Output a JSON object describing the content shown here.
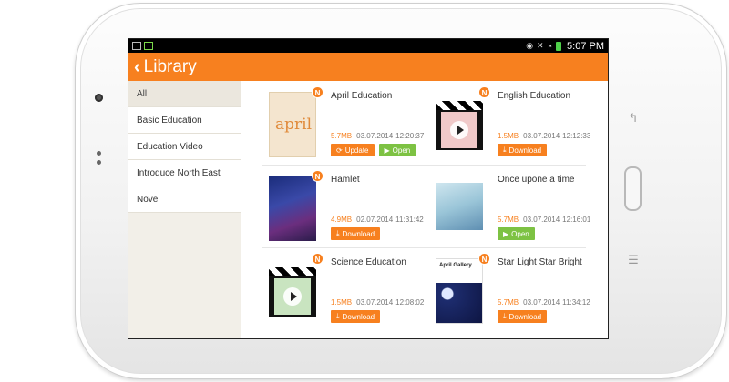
{
  "statusbar": {
    "time": "5:07 PM"
  },
  "appbar": {
    "back_icon": "chevron-left-icon",
    "title": "Library"
  },
  "sidebar": {
    "items": [
      {
        "label": "All",
        "active": true
      },
      {
        "label": "Basic Education"
      },
      {
        "label": "Education Video"
      },
      {
        "label": "Introduce North East"
      },
      {
        "label": "Novel"
      }
    ]
  },
  "badge_label": "N",
  "colors": {
    "accent": "#f7801f",
    "open": "#7dc243"
  },
  "books": [
    {
      "title": "April Education",
      "size": "5.7MB",
      "date": "03.07.2014",
      "time": "12:20:37",
      "buttons": [
        "Update",
        "Open"
      ],
      "cover_text": "april"
    },
    {
      "title": "English Education",
      "size": "1.5MB",
      "date": "03.07.2014",
      "time": "12:12:33",
      "buttons": [
        "Download"
      ]
    },
    {
      "title": "Hamlet",
      "size": "4.9MB",
      "date": "02.07.2014",
      "time": "11:31:42",
      "buttons": [
        "Download"
      ]
    },
    {
      "title": "Once upone a time",
      "size": "5.7MB",
      "date": "03.07.2014",
      "time": "12:16:01",
      "buttons": [
        "Open"
      ]
    },
    {
      "title": "Science Education",
      "size": "1.5MB",
      "date": "03.07.2014",
      "time": "12:08:02",
      "buttons": [
        "Download"
      ]
    },
    {
      "title": "Star Light Star Bright",
      "size": "5.7MB",
      "date": "03.07.2014",
      "time": "11:34:12",
      "buttons": [
        "Download"
      ],
      "cover_text": "April Gallery"
    }
  ]
}
